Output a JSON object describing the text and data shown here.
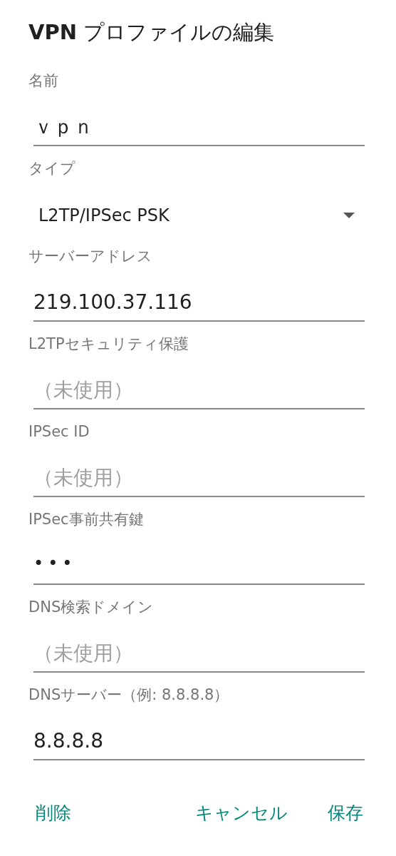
{
  "dialog": {
    "title": "**VPN** プロファイルの編集",
    "fields": [
      {
        "kind": "text",
        "label": "名前",
        "value": "ｖｐｎ"
      },
      {
        "kind": "select",
        "label": "タイプ",
        "value": "L2TP/IPSec PSK"
      },
      {
        "kind": "text",
        "label": "サーバーアドレス",
        "value": "219.100.37.116"
      },
      {
        "kind": "text",
        "label": "L2TPセキュリティ保護",
        "placeholder": "（未使用）"
      },
      {
        "kind": "text",
        "label": "IPSec ID",
        "placeholder": "（未使用）"
      },
      {
        "kind": "password",
        "label": "IPSec事前共有鍵",
        "value": "•••"
      },
      {
        "kind": "text",
        "label": "DNS検索ドメイン",
        "placeholder": "（未使用）"
      },
      {
        "kind": "text",
        "label": "DNSサーバー（例: 8.8.8.8）",
        "value": "8.8.8.8"
      }
    ],
    "buttons": [
      {
        "label": "削除"
      },
      {
        "label": "キャンセル"
      },
      {
        "label": "保存"
      }
    ]
  }
}
